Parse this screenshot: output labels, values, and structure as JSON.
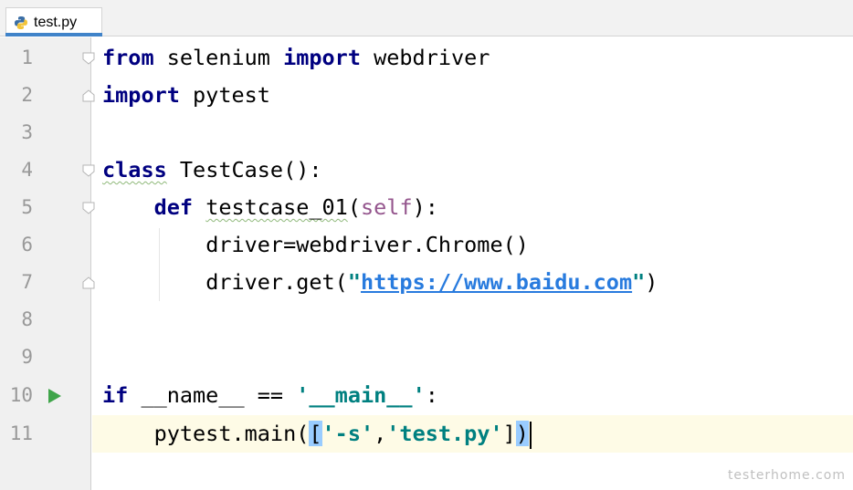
{
  "tab": {
    "label": "test.py",
    "icon": "python-file-icon",
    "accent": "#4083c9"
  },
  "editor": {
    "line_numbers": [
      "1",
      "2",
      "3",
      "4",
      "5",
      "6",
      "7",
      "8",
      "9",
      "10",
      "11"
    ],
    "current_line": "11",
    "colors": {
      "keyword": "#000080",
      "self": "#94558d",
      "string": "#008080",
      "url": "#287bde",
      "current_line_bg": "#fefbe6",
      "bracket_highlight": "#99ccff"
    },
    "lines": {
      "l1": {
        "kw1": "from",
        "t1": " selenium ",
        "kw2": "import",
        "t2": " webdriver"
      },
      "l2": {
        "kw1": "import",
        "t1": " pytest"
      },
      "l4": {
        "kw1": "class",
        "t1": " TestCase():"
      },
      "l5": {
        "indent": "    ",
        "kw1": "def",
        "t1": " ",
        "fn": "testcase_01",
        "t2": "(",
        "self": "self",
        "t3": "):"
      },
      "l6": {
        "indent": "        ",
        "t1": "driver=webdriver.Chrome()"
      },
      "l7": {
        "indent": "        ",
        "t1": "driver.get(",
        "q1": "\"",
        "url": "https://www.baidu.com",
        "q2": "\"",
        "t2": ")"
      },
      "l10": {
        "kw1": "if",
        "t1": " __name__ == ",
        "str": "'__main__'",
        "t2": ":"
      },
      "l11": {
        "indent": "    ",
        "t1": "pytest.main(",
        "b1": "[",
        "s1": "'-s'",
        "comma": ",",
        "s2": "'test.py'",
        "b2": "]",
        "b3": ")"
      }
    }
  },
  "watermark": "testerhome.com"
}
